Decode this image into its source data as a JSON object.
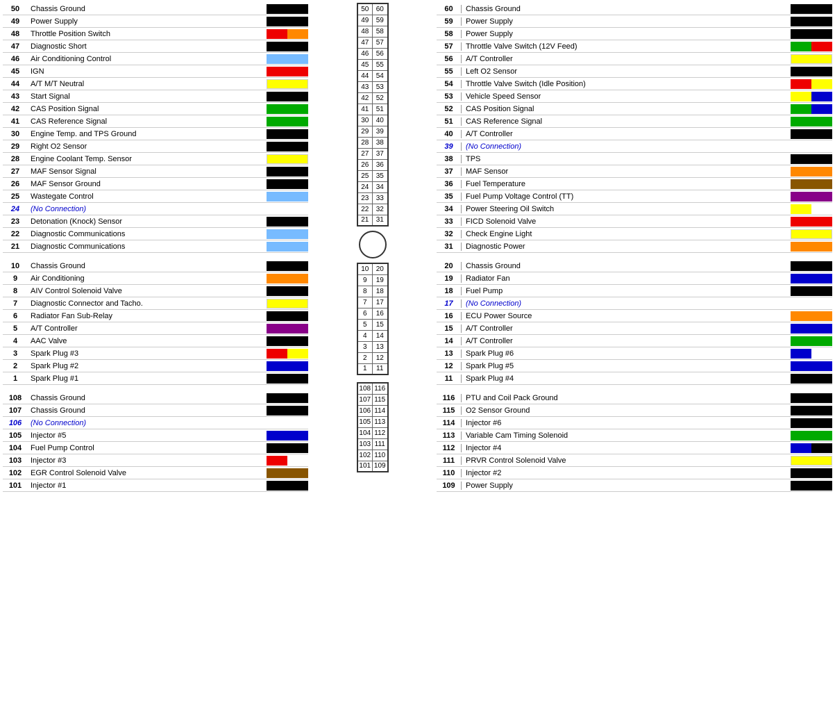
{
  "left": {
    "section1": [
      {
        "num": 50,
        "label": "Chassis Ground",
        "color": "black"
      },
      {
        "num": 49,
        "label": "Power Supply",
        "color": "black"
      },
      {
        "num": 48,
        "label": "Throttle Position Switch",
        "color": "multicolor-ro"
      },
      {
        "num": 47,
        "label": "Diagnostic Short",
        "color": "black"
      },
      {
        "num": 46,
        "label": "Air Conditioning Control",
        "color": "lightblue"
      },
      {
        "num": 45,
        "label": "IGN",
        "color": "red"
      },
      {
        "num": 44,
        "label": "A/T M/T Neutral",
        "color": "yellow"
      },
      {
        "num": 43,
        "label": "Start Signal",
        "color": "black"
      },
      {
        "num": 42,
        "label": "CAS Position Signal",
        "color": "green"
      },
      {
        "num": 41,
        "label": "CAS Reference Signal",
        "color": "green"
      },
      {
        "num": 30,
        "label": "Engine Temp. and TPS Ground",
        "color": "black"
      },
      {
        "num": 29,
        "label": "Right O2 Sensor",
        "color": "black"
      },
      {
        "num": 28,
        "label": "Engine Coolant Temp. Sensor",
        "color": "yellow"
      },
      {
        "num": 27,
        "label": "MAF Sensor Signal",
        "color": "black"
      },
      {
        "num": 26,
        "label": "MAF Sensor Ground",
        "color": "black"
      },
      {
        "num": 25,
        "label": "Wastegate Control",
        "color": "lightblue"
      },
      {
        "num": 24,
        "label": "(No Connection)",
        "color": "nocolor"
      },
      {
        "num": 23,
        "label": "Detonation (Knock) Sensor",
        "color": "black"
      },
      {
        "num": 22,
        "label": "Diagnostic Communications",
        "color": "lightblue"
      },
      {
        "num": 21,
        "label": "Diagnostic Communications",
        "color": "lightblue"
      }
    ],
    "section2": [
      {
        "num": 10,
        "label": "Chassis Ground",
        "color": "black"
      },
      {
        "num": 9,
        "label": "Air Conditioning",
        "color": "orange"
      },
      {
        "num": 8,
        "label": "AIV Control Solenoid Valve",
        "color": "black"
      },
      {
        "num": 7,
        "label": "Diagnostic Connector and Tacho.",
        "color": "yellow"
      },
      {
        "num": 6,
        "label": "Radiator Fan Sub-Relay",
        "color": "black"
      },
      {
        "num": 5,
        "label": "A/T Controller",
        "color": "purple"
      },
      {
        "num": 4,
        "label": "AAC Valve",
        "color": "black"
      },
      {
        "num": 3,
        "label": "Spark Plug #3",
        "color": "multicolor-ry"
      },
      {
        "num": 2,
        "label": "Spark Plug #2",
        "color": "blue"
      },
      {
        "num": 1,
        "label": "Spark Plug #1",
        "color": "black"
      }
    ],
    "section3": [
      {
        "num": 108,
        "label": "Chassis Ground",
        "color": "black"
      },
      {
        "num": 107,
        "label": "Chassis Ground",
        "color": "black"
      },
      {
        "num": 106,
        "label": "(No Connection)",
        "color": "nocolor"
      },
      {
        "num": 105,
        "label": "Injector #5",
        "color": "blue"
      },
      {
        "num": 104,
        "label": "Fuel Pump Control",
        "color": "black"
      },
      {
        "num": 103,
        "label": "Injector #3",
        "color": "multicolor-rw"
      },
      {
        "num": 102,
        "label": "EGR Control Solenoid Valve",
        "color": "brown"
      },
      {
        "num": 101,
        "label": "Injector #1",
        "color": "black"
      }
    ]
  },
  "right": {
    "section1": [
      {
        "num": 60,
        "label": "Chassis Ground",
        "color": "black"
      },
      {
        "num": 59,
        "label": "Power Supply",
        "color": "black"
      },
      {
        "num": 58,
        "label": "Power Supply",
        "color": "black"
      },
      {
        "num": 57,
        "label": "Throttle Valve Switch (12V Feed)",
        "color": "multicolor-gr"
      },
      {
        "num": 56,
        "label": "A/T Controller",
        "color": "yellow"
      },
      {
        "num": 55,
        "label": "Left O2 Sensor",
        "color": "black"
      },
      {
        "num": 54,
        "label": "Throttle Valve Switch (Idle Position)",
        "color": "multicolor-ry"
      },
      {
        "num": 53,
        "label": "Vehicle Speed Sensor",
        "color": "multicolor-yb"
      },
      {
        "num": 52,
        "label": "CAS Position Signal",
        "color": "multicolor-gb"
      },
      {
        "num": 51,
        "label": "CAS Reference Signal",
        "color": "green"
      },
      {
        "num": 40,
        "label": "A/T Controller",
        "color": "black"
      },
      {
        "num": 39,
        "label": "(No Connection)",
        "color": "nocolor"
      },
      {
        "num": 38,
        "label": "TPS",
        "color": "black"
      },
      {
        "num": 37,
        "label": "MAF Sensor",
        "color": "orange"
      },
      {
        "num": 36,
        "label": "Fuel Temperature",
        "color": "brown"
      },
      {
        "num": 35,
        "label": "Fuel Pump Voltage Control (TT)",
        "color": "purple"
      },
      {
        "num": 34,
        "label": "Power Steering Oil Switch",
        "color": "multicolor-yw"
      },
      {
        "num": 33,
        "label": "FICD Solenoid Valve",
        "color": "red"
      },
      {
        "num": 32,
        "label": "Check Engine Light",
        "color": "yellow"
      },
      {
        "num": 31,
        "label": "Diagnostic Power",
        "color": "orange"
      }
    ],
    "section2": [
      {
        "num": 20,
        "label": "Chassis Ground",
        "color": "black"
      },
      {
        "num": 19,
        "label": "Radiator Fan",
        "color": "blue"
      },
      {
        "num": 18,
        "label": "Fuel Pump",
        "color": "black"
      },
      {
        "num": 17,
        "label": "(No Connection)",
        "color": "nocolor"
      },
      {
        "num": 16,
        "label": "ECU Power Source",
        "color": "orange"
      },
      {
        "num": 15,
        "label": "A/T Controller",
        "color": "blue"
      },
      {
        "num": 14,
        "label": "A/T Controller",
        "color": "green"
      },
      {
        "num": 13,
        "label": "Spark Plug #6",
        "color": "multicolor-bw"
      },
      {
        "num": 12,
        "label": "Spark Plug #5",
        "color": "blue"
      },
      {
        "num": 11,
        "label": "Spark Plug #4",
        "color": "black"
      }
    ],
    "section3": [
      {
        "num": 116,
        "label": "PTU and Coil Pack Ground",
        "color": "black"
      },
      {
        "num": 115,
        "label": "O2 Sensor Ground",
        "color": "black"
      },
      {
        "num": 114,
        "label": "Injector #6",
        "color": "black"
      },
      {
        "num": 113,
        "label": "Variable Cam Timing Solenoid",
        "color": "green"
      },
      {
        "num": 112,
        "label": "Injector #4",
        "color": "multicolor-bk"
      },
      {
        "num": 111,
        "label": "PRVR Control Solenoid Valve",
        "color": "yellow"
      },
      {
        "num": 110,
        "label": "Injector #2",
        "color": "black"
      },
      {
        "num": 109,
        "label": "Power Supply",
        "color": "black"
      }
    ]
  },
  "center": {
    "top_pairs": [
      [
        50,
        60
      ],
      [
        49,
        59
      ],
      [
        48,
        58
      ],
      [
        47,
        57
      ],
      [
        46,
        56
      ],
      [
        45,
        55
      ],
      [
        44,
        54
      ],
      [
        43,
        53
      ],
      [
        42,
        52
      ],
      [
        41,
        51
      ],
      [
        30,
        40
      ],
      [
        29,
        39
      ],
      [
        28,
        38
      ],
      [
        27,
        37
      ],
      [
        26,
        36
      ],
      [
        25,
        35
      ],
      [
        24,
        34
      ],
      [
        23,
        33
      ],
      [
        22,
        32
      ],
      [
        21,
        31
      ]
    ],
    "mid_pairs": [
      [
        10,
        20
      ],
      [
        9,
        19
      ],
      [
        8,
        18
      ],
      [
        7,
        17
      ],
      [
        6,
        16
      ],
      [
        5,
        15
      ],
      [
        4,
        14
      ],
      [
        3,
        13
      ],
      [
        2,
        12
      ],
      [
        1,
        11
      ]
    ],
    "bot_pairs": [
      [
        108,
        116
      ],
      [
        107,
        115
      ],
      [
        106,
        114
      ],
      [
        105,
        113
      ],
      [
        104,
        112
      ],
      [
        103,
        111
      ],
      [
        102,
        110
      ],
      [
        101,
        109
      ]
    ]
  }
}
